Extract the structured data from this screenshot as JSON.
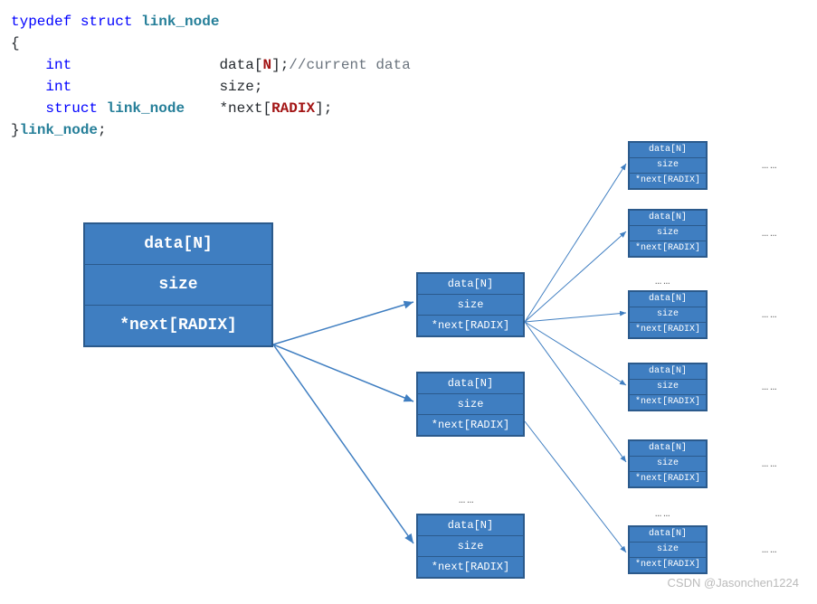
{
  "code": {
    "typedef": "typedef",
    "struct": "struct",
    "type_name": "link_node",
    "open": "{",
    "int": "int",
    "field_data": "data",
    "macro_n": "N",
    "comment_data": "//current data",
    "field_size": "size",
    "field_next_pre": "*next",
    "macro_radix": "RADIX",
    "close": "}",
    "semi": ";",
    "lbr": "[",
    "rbr": "]"
  },
  "node_labels": {
    "data": "data[N]",
    "size": "size",
    "next": "*next[RADIX]"
  },
  "dots": "……",
  "watermark": "CSDN @Jasonchen1224"
}
